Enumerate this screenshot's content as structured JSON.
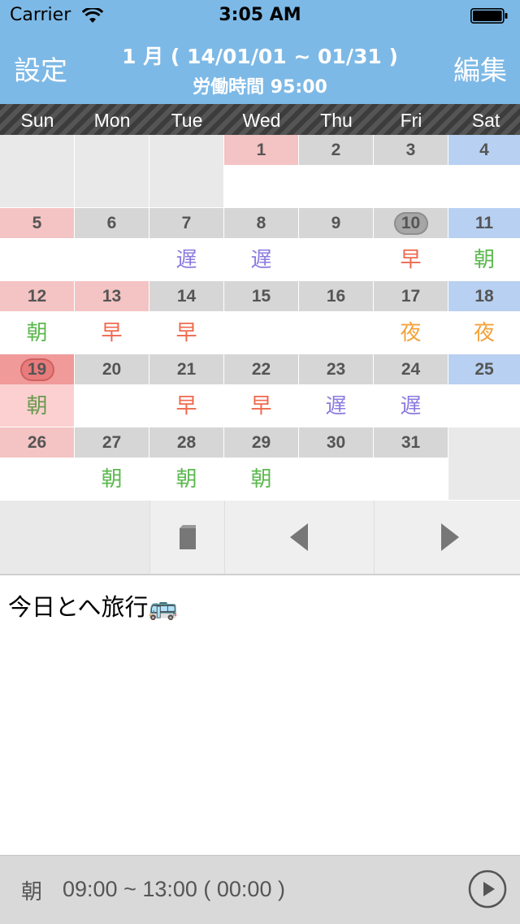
{
  "status": {
    "carrier": "Carrier",
    "time": "3:05 AM"
  },
  "nav": {
    "left": "設定",
    "right": "編集",
    "title": "1 月 ( 14/01/01 ~ 01/31 )",
    "subtitle": "労働時間 95:00"
  },
  "weekdays": [
    "Sun",
    "Mon",
    "Tue",
    "Wed",
    "Thu",
    "Fri",
    "Sat"
  ],
  "calendar": {
    "days": [
      {
        "d": "1",
        "shift": "",
        "holiday": true
      },
      {
        "d": "2",
        "shift": ""
      },
      {
        "d": "3",
        "shift": ""
      },
      {
        "d": "4",
        "shift": ""
      },
      {
        "d": "5",
        "shift": ""
      },
      {
        "d": "6",
        "shift": ""
      },
      {
        "d": "7",
        "shift": "遅",
        "type": "late"
      },
      {
        "d": "8",
        "shift": "遅",
        "type": "late"
      },
      {
        "d": "9",
        "shift": ""
      },
      {
        "d": "10",
        "shift": "早",
        "type": "early",
        "badge": true
      },
      {
        "d": "11",
        "shift": "朝",
        "type": "morning"
      },
      {
        "d": "12",
        "shift": "朝",
        "type": "morning"
      },
      {
        "d": "13",
        "shift": "早",
        "type": "early",
        "holiday": true
      },
      {
        "d": "14",
        "shift": "早",
        "type": "early"
      },
      {
        "d": "15",
        "shift": ""
      },
      {
        "d": "16",
        "shift": ""
      },
      {
        "d": "17",
        "shift": "夜",
        "type": "night"
      },
      {
        "d": "18",
        "shift": "夜",
        "type": "night"
      },
      {
        "d": "19",
        "shift": "朝",
        "type": "morning-today",
        "today": true
      },
      {
        "d": "20",
        "shift": ""
      },
      {
        "d": "21",
        "shift": "早",
        "type": "early"
      },
      {
        "d": "22",
        "shift": "早",
        "type": "early"
      },
      {
        "d": "23",
        "shift": "遅",
        "type": "late"
      },
      {
        "d": "24",
        "shift": "遅",
        "type": "late"
      },
      {
        "d": "25",
        "shift": ""
      },
      {
        "d": "26",
        "shift": ""
      },
      {
        "d": "27",
        "shift": "朝",
        "type": "morning"
      },
      {
        "d": "28",
        "shift": "朝",
        "type": "morning"
      },
      {
        "d": "29",
        "shift": "朝",
        "type": "morning"
      },
      {
        "d": "30",
        "shift": ""
      },
      {
        "d": "31",
        "shift": ""
      }
    ]
  },
  "memo": "今日とへ旅行🚌",
  "footer": {
    "shift_label": "朝",
    "time_range": "09:00 ~ 13:00 ( 00:00 )"
  },
  "icons": {
    "stop": "stop-icon",
    "prev": "prev-icon",
    "next": "next-icon",
    "play": "play-icon"
  }
}
